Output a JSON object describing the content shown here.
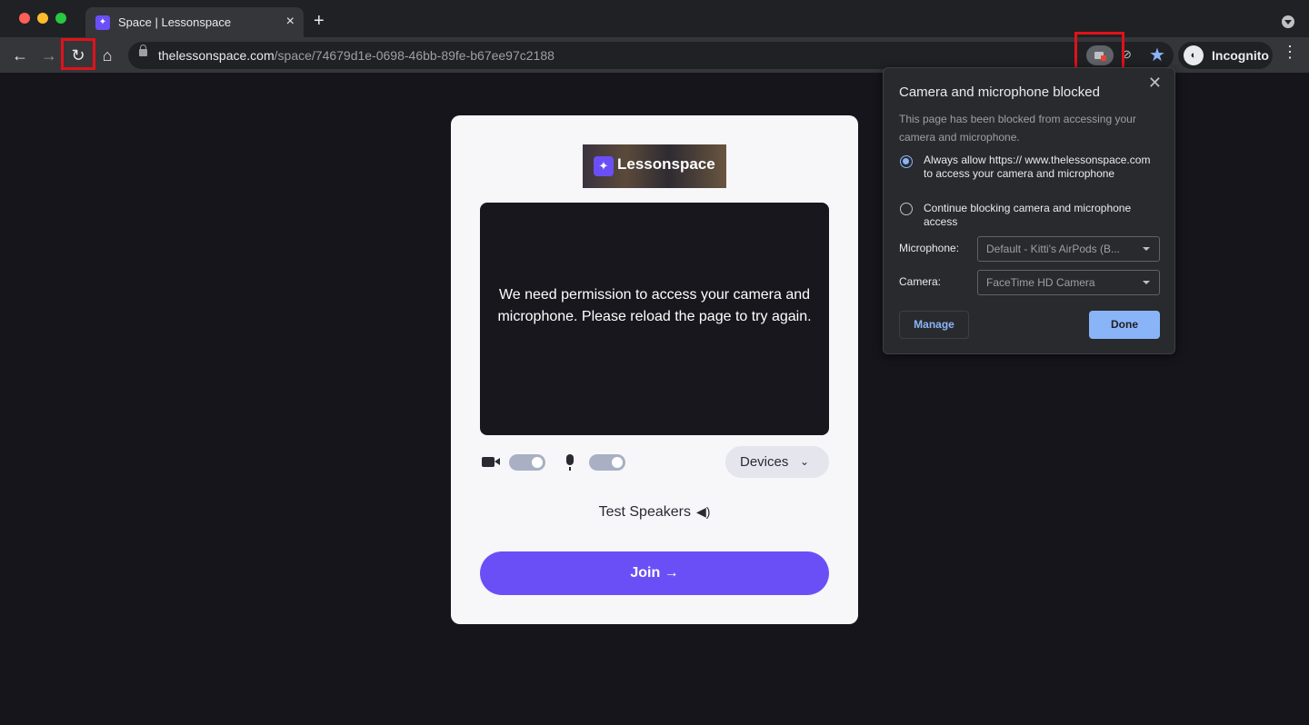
{
  "window": {
    "tab_title": "Space | Lessonspace",
    "tab_close": "×",
    "new_tab": "+"
  },
  "toolbar": {
    "back": "←",
    "forward": "→",
    "reload": "↻",
    "home": "⌂",
    "url_host": "thelessonspace.com",
    "url_path": "/space/74679d1e-0698-46bb-89fe-b67ee97c2188",
    "star": "★",
    "eye_off": "⊘",
    "profile_label": "Incognito",
    "profile_avatar": "◐",
    "menu": "⋮"
  },
  "page": {
    "logo_mark": "✦",
    "logo_text": "Lessonspace",
    "permission_message": "We need permission to access your camera and microphone. Please reload the page to try again.",
    "devices_label": "Devices",
    "devices_chevron": "⌄",
    "test_speakers": "Test Speakers",
    "speaker_icon": "◀)",
    "join_label": "Join →"
  },
  "permission_bubble": {
    "title": "Camera and microphone blocked",
    "close": "✕",
    "description": "This page has been blocked from accessing your camera and microphone.",
    "option_allow": "Always allow https:// www.thelessonspace.com to access your camera and microphone",
    "option_block": "Continue blocking camera and microphone access",
    "selected_option": "allow",
    "microphone_label": "Microphone:",
    "microphone_value": "Default - Kitti's AirPods (B...",
    "camera_label": "Camera:",
    "camera_value": "FaceTime HD Camera",
    "manage_label": "Manage",
    "done_label": "Done"
  },
  "colors": {
    "accent": "#6b4ff6",
    "highlight": "#e0121a",
    "chrome_blue": "#8ab4f8"
  }
}
